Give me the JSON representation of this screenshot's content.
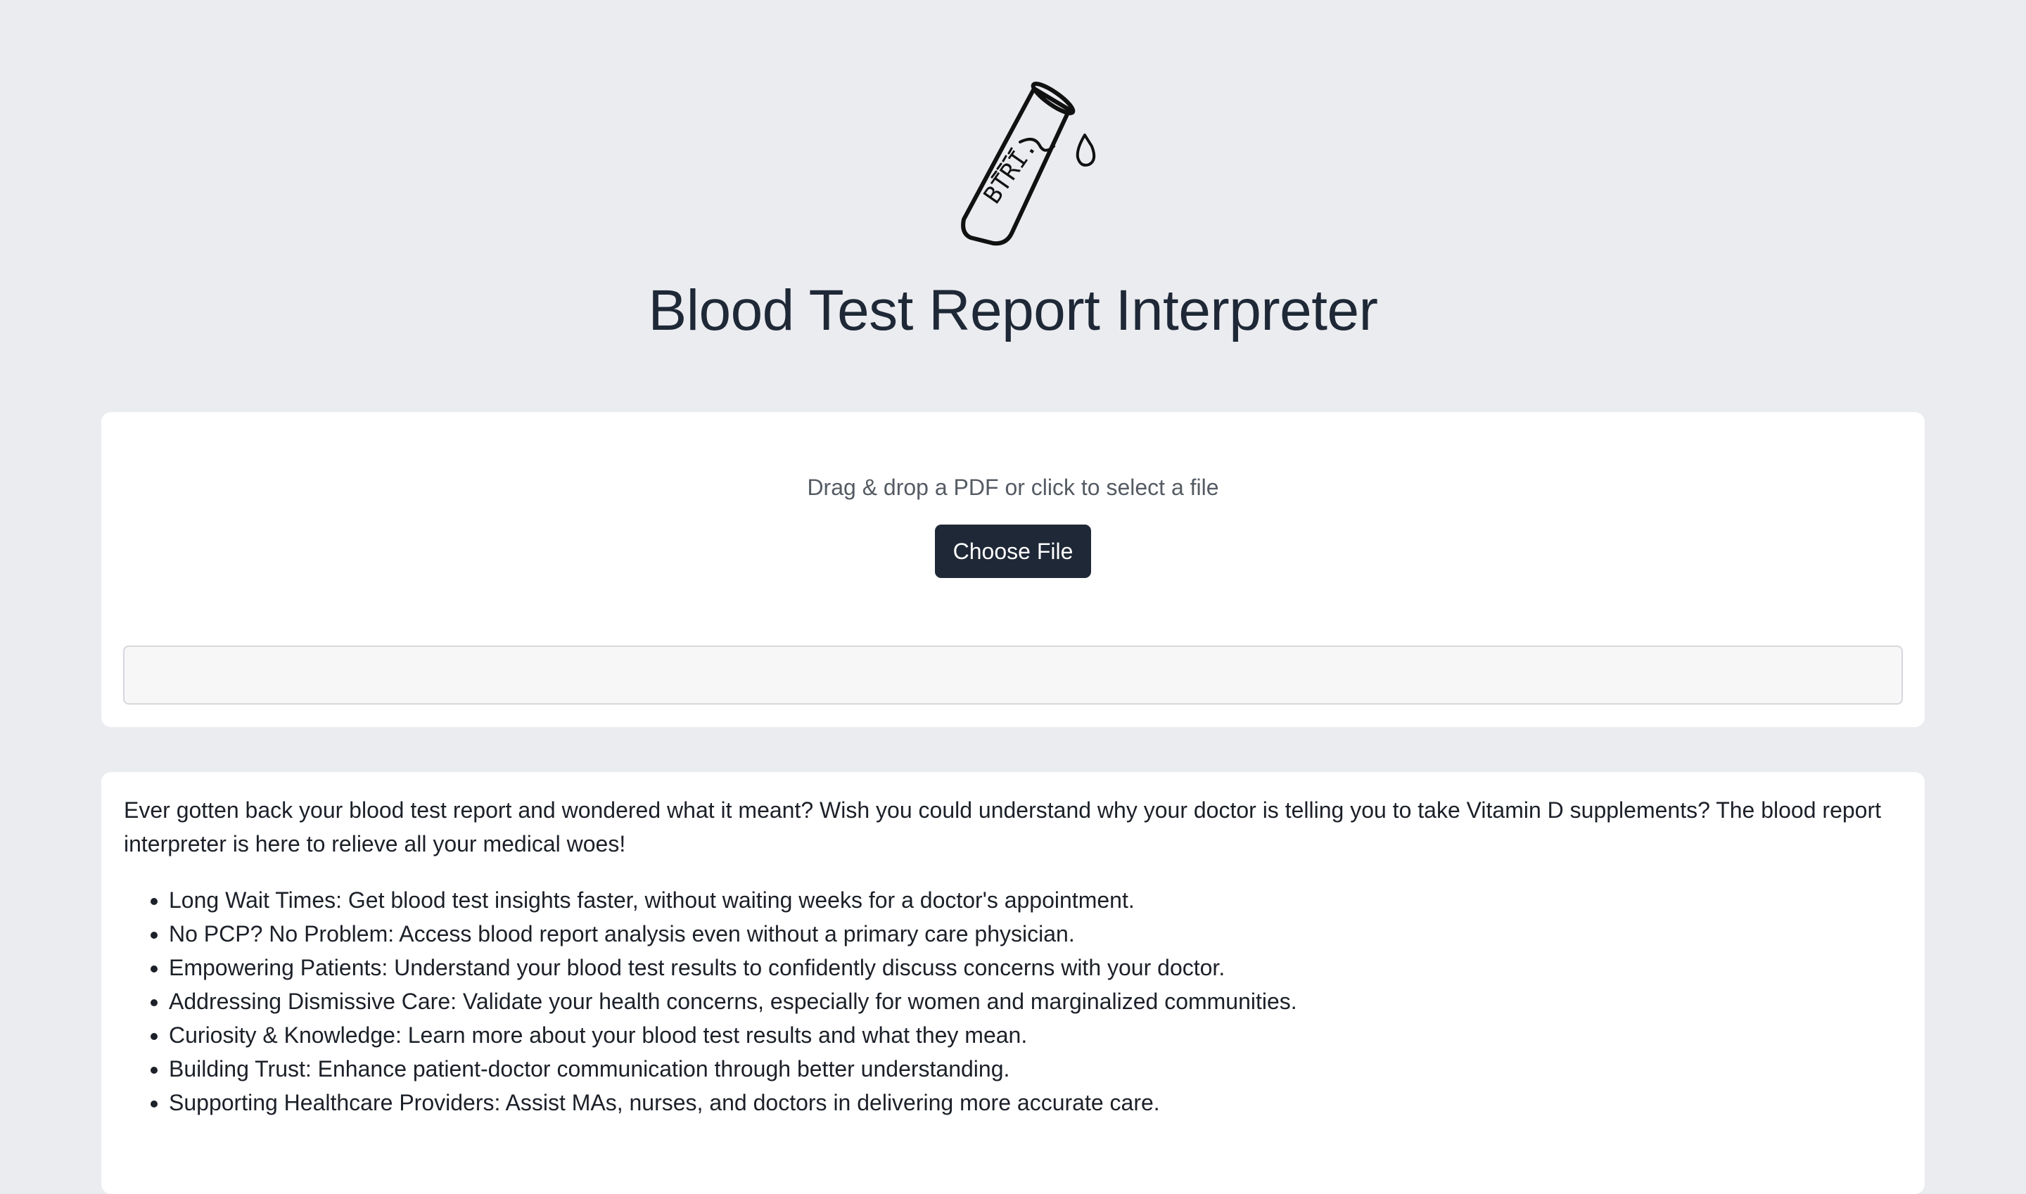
{
  "header": {
    "logo_text": "BTRI.",
    "title": "Blood Test Report Interpreter"
  },
  "upload": {
    "drop_text": "Drag & drop a PDF or click to select a file",
    "button_label": "Choose File",
    "result_value": ""
  },
  "info": {
    "intro": "Ever gotten back your blood test report and wondered what it meant? Wish you could understand why your doctor is telling you to take Vitamin D supplements? The blood report interpreter is here to relieve all your medical woes!",
    "benefits": [
      "Long Wait Times: Get blood test insights faster, without waiting weeks for a doctor's appointment.",
      "No PCP? No Problem: Access blood report analysis even without a primary care physician.",
      "Empowering Patients: Understand your blood test results to confidently discuss concerns with your doctor.",
      "Addressing Dismissive Care: Validate your health concerns, especially for women and marginalized communities.",
      "Curiosity & Knowledge: Learn more about your blood test results and what they mean.",
      "Building Trust: Enhance patient-doctor communication through better understanding.",
      "Supporting Healthcare Providers: Assist MAs, nurses, and doctors in delivering more accurate care."
    ]
  }
}
